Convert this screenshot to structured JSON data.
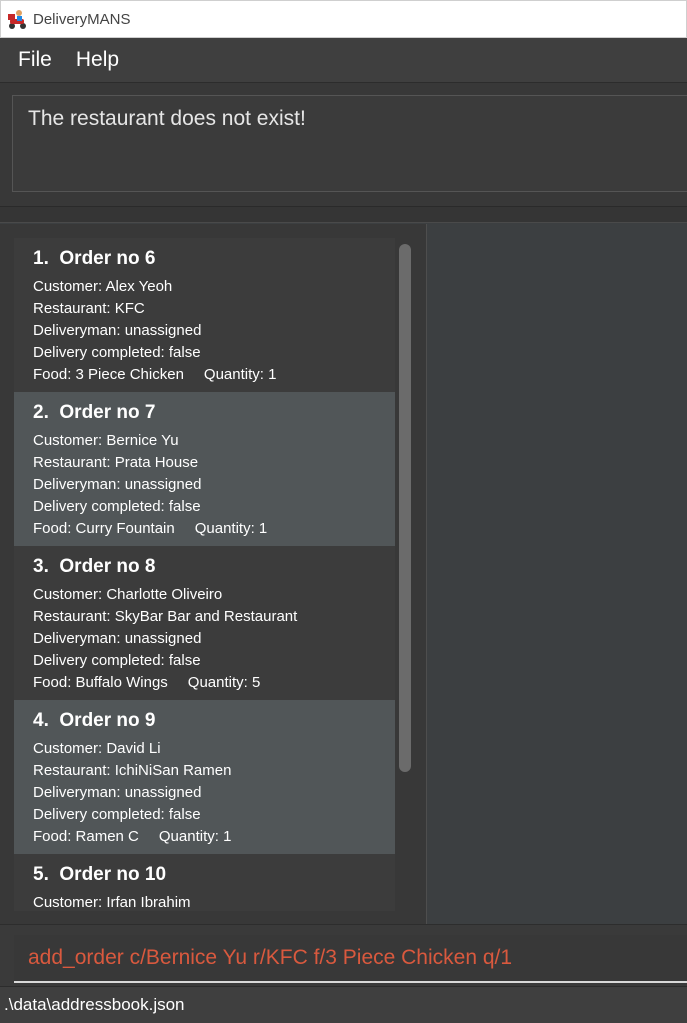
{
  "window": {
    "title": "DeliveryMANS",
    "icon": "delivery-scooter-icon"
  },
  "menu": {
    "items": [
      {
        "label": "File"
      },
      {
        "label": "Help"
      }
    ]
  },
  "result": {
    "text": "The restaurant does not exist!"
  },
  "orders": [
    {
      "title": "1.  Order no 6",
      "customer": "Customer: Alex Yeoh",
      "restaurant": "Restaurant: KFC",
      "deliveryman": "Deliveryman: unassigned",
      "completed": "Delivery completed: false",
      "food": "Food: 3 Piece Chicken",
      "quantity": "Quantity: 1"
    },
    {
      "title": "2.  Order no 7",
      "customer": "Customer: Bernice Yu",
      "restaurant": "Restaurant: Prata House",
      "deliveryman": "Deliveryman: unassigned",
      "completed": "Delivery completed: false",
      "food": "Food: Curry Fountain",
      "quantity": "Quantity: 1"
    },
    {
      "title": "3.  Order no 8",
      "customer": "Customer: Charlotte Oliveiro",
      "restaurant": "Restaurant: SkyBar Bar and Restaurant",
      "deliveryman": "Deliveryman: unassigned",
      "completed": "Delivery completed: false",
      "food": "Food: Buffalo Wings",
      "quantity": "Quantity: 5"
    },
    {
      "title": "4.  Order no 9",
      "customer": "Customer: David Li",
      "restaurant": "Restaurant: IchiNiSan Ramen",
      "deliveryman": "Deliveryman: unassigned",
      "completed": "Delivery completed: false",
      "food": "Food: Ramen C",
      "quantity": "Quantity: 1"
    },
    {
      "title": "5.  Order no 10",
      "customer": "Customer: Irfan Ibrahim",
      "restaurant": "",
      "deliveryman": "",
      "completed": "",
      "food": "",
      "quantity": ""
    }
  ],
  "command": {
    "value": "add_order c/Bernice Yu r/KFC f/3 Piece Chicken q/1"
  },
  "status": {
    "path": ".\\data\\addressbook.json"
  },
  "colors": {
    "command_text": "#d9593e",
    "card_alt": "#515658",
    "card_base": "#3c3c3c"
  }
}
